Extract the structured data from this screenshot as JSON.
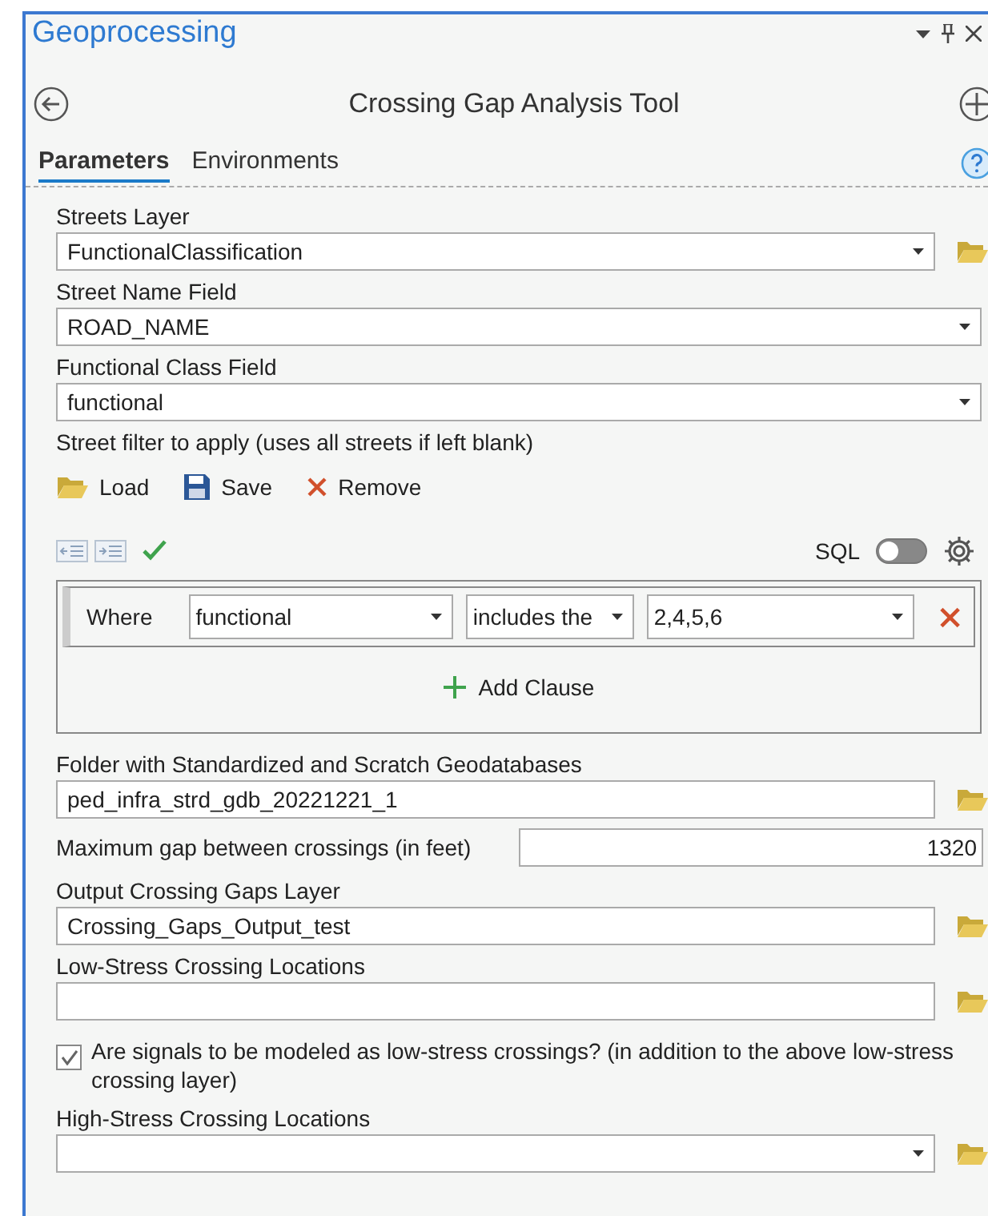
{
  "panel": {
    "title": "Geoprocessing"
  },
  "tool": {
    "title": "Crossing Gap Analysis Tool"
  },
  "tabs": [
    {
      "label": "Parameters",
      "selected": true
    },
    {
      "label": "Environments",
      "selected": false
    }
  ],
  "parameters": [
    {
      "kind": "field",
      "label": "Streets Layer",
      "value": "FunctionalClassification",
      "dropdown": true,
      "browse": true
    },
    {
      "kind": "field",
      "label": "Street Name Field",
      "value": "ROAD_NAME",
      "dropdown": true,
      "browse": false
    },
    {
      "kind": "field",
      "label": "Functional Class Field",
      "value": "functional",
      "dropdown": true,
      "browse": false
    },
    {
      "kind": "filter",
      "label": "Street filter to apply (uses all streets if left blank)",
      "actions": [
        {
          "kind": "load",
          "label": "Load"
        },
        {
          "kind": "save",
          "label": "Save"
        },
        {
          "kind": "remove",
          "label": "Remove"
        }
      ],
      "sql_label": "SQL",
      "sql_on": false,
      "clause": {
        "keyword": "Where",
        "field": "functional",
        "operator": "includes the",
        "values": "2,4,5,6"
      },
      "add_label": "Add Clause"
    },
    {
      "kind": "field",
      "label": "Folder with Standardized and Scratch Geodatabases",
      "value": "ped_infra_strd_gdb_20221221_1",
      "dropdown": false,
      "browse": true
    },
    {
      "kind": "number",
      "label": "Maximum gap between crossings (in feet)",
      "value": "1320"
    },
    {
      "kind": "field",
      "label": "Output Crossing Gaps Layer",
      "value": "Crossing_Gaps_Output_test",
      "dropdown": false,
      "browse": true
    },
    {
      "kind": "field",
      "label": "Low-Stress Crossing Locations",
      "dropdown": false,
      "browse": true
    },
    {
      "kind": "checkbox",
      "label": "Are signals to be modeled as low-stress crossings? (in addition to the above low-stress crossing layer)",
      "checked": true
    },
    {
      "kind": "field",
      "label": "High-Stress Crossing Locations",
      "dropdown": true,
      "browse": true
    }
  ]
}
